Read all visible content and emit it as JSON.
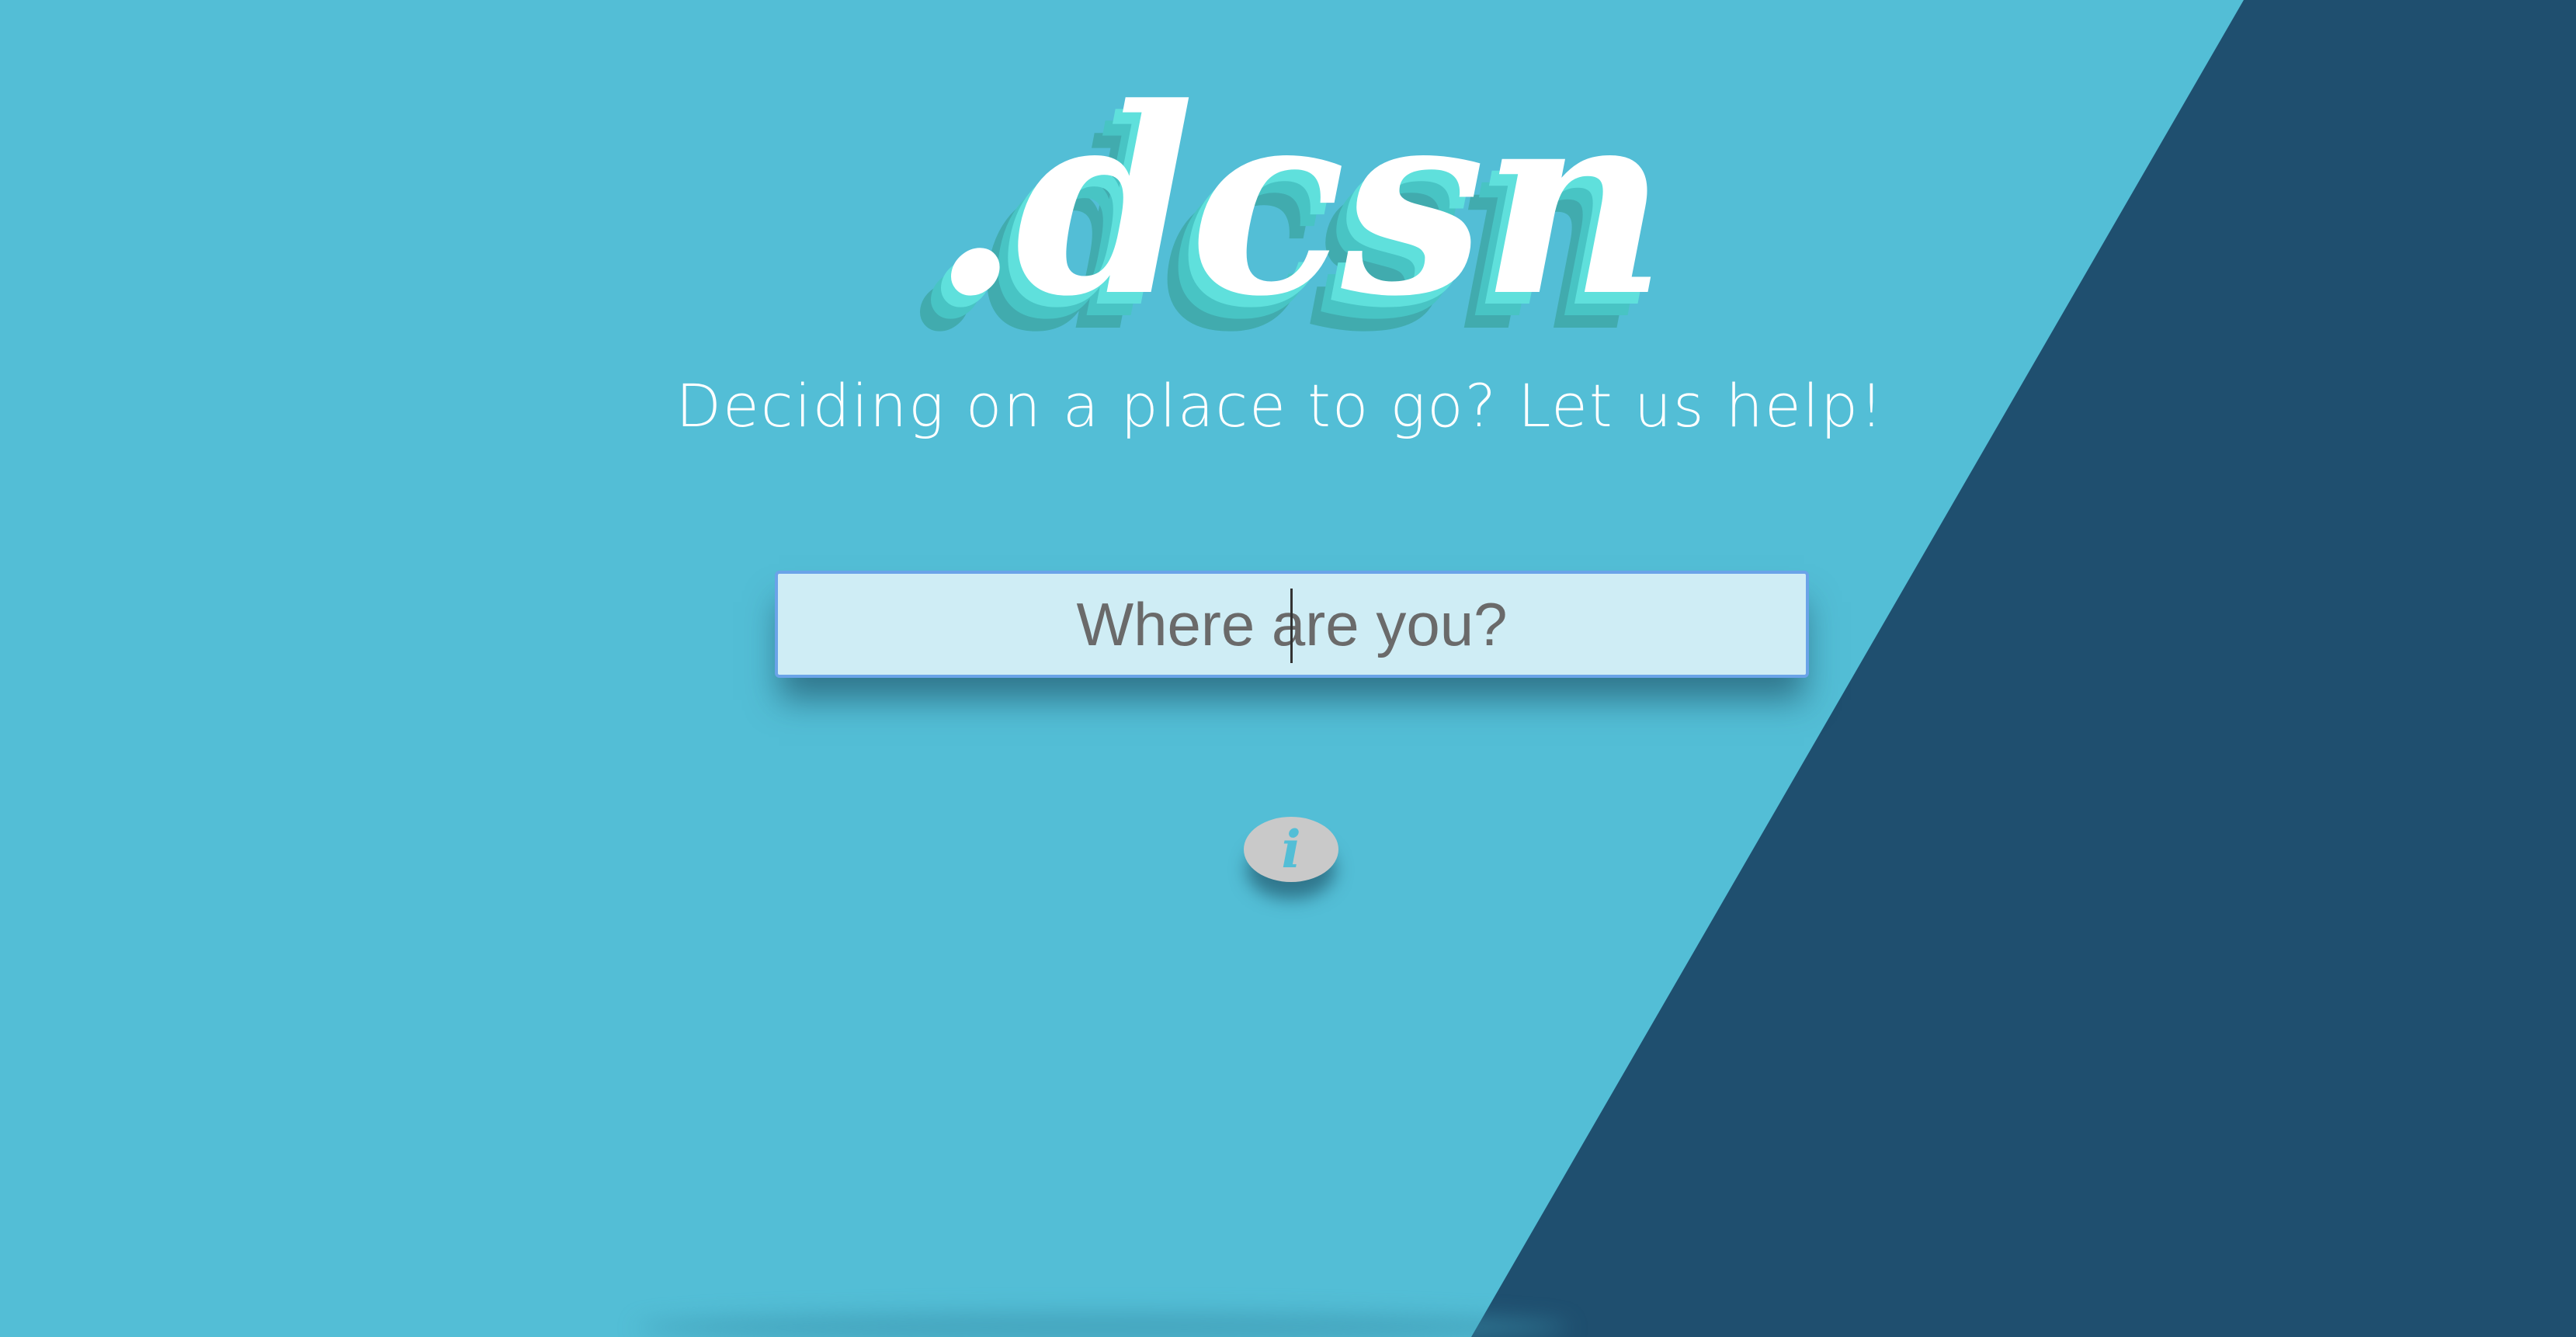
{
  "logo": {
    "text": ".dcsn"
  },
  "tagline": {
    "text": "Deciding on a place to go? Let us help!"
  },
  "search": {
    "placeholder": "Where are you?",
    "value": ""
  },
  "info_button": {
    "icon": "info-icon",
    "glyph": "i"
  },
  "colors": {
    "background": "#53bed6",
    "diagonal_panel": "#1f4f6f",
    "logo_white": "#ffffff",
    "logo_shadow": "#5fe0dc",
    "input_bg": "#cfedf5",
    "input_border": "#6aa3e8",
    "info_bg": "#c9c9c9"
  }
}
